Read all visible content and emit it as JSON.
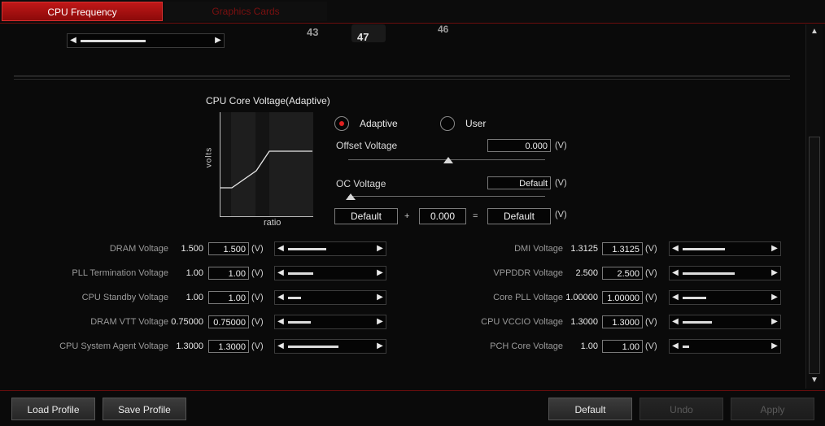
{
  "tabs": [
    {
      "label": "CPU Frequency"
    },
    {
      "label": "Graphics Cards"
    }
  ],
  "ratio_markers": [
    "43",
    "47",
    "46"
  ],
  "adaptive": {
    "title": "CPU Core Voltage(Adaptive)",
    "graph_ylabel": "volts",
    "graph_xlabel": "ratio",
    "mode_adaptive": "Adaptive",
    "mode_user": "User",
    "selected_mode": "Adaptive",
    "offset_label": "Offset Voltage",
    "offset_value": "0.000",
    "offset_unit": "(V)",
    "oc_label": "OC Voltage",
    "oc_value": "Default",
    "oc_unit": "(V)",
    "formula_left": "Default",
    "formula_plus": "+",
    "formula_mid": "0.000",
    "formula_eq": "=",
    "formula_result": "Default",
    "formula_unit": "(V)"
  },
  "unit": "(V)",
  "left_voltages": [
    {
      "label": "DRAM Voltage",
      "current": "1.500",
      "value": "1.500",
      "level": 0.45
    },
    {
      "label": "PLL Termination Voltage",
      "current": "1.00",
      "value": "1.00",
      "level": 0.3
    },
    {
      "label": "CPU Standby Voltage",
      "current": "1.00",
      "value": "1.00",
      "level": 0.15
    },
    {
      "label": "DRAM VTT Voltage",
      "current": "0.75000",
      "value": "0.75000",
      "level": 0.27
    },
    {
      "label": "CPU System Agent Voltage",
      "current": "1.3000",
      "value": "1.3000",
      "level": 0.6
    }
  ],
  "right_voltages": [
    {
      "label": "DMI Voltage",
      "current": "1.3125",
      "value": "1.3125",
      "level": 0.5
    },
    {
      "label": "VPPDDR Voltage",
      "current": "2.500",
      "value": "2.500",
      "level": 0.62
    },
    {
      "label": "Core PLL Voltage",
      "current": "1.00000",
      "value": "1.00000",
      "level": 0.28
    },
    {
      "label": "CPU VCCIO Voltage",
      "current": "1.3000",
      "value": "1.3000",
      "level": 0.35
    },
    {
      "label": "PCH Core Voltage",
      "current": "1.00",
      "value": "1.00",
      "level": 0.08
    }
  ],
  "bottom": {
    "load_profile": "Load Profile",
    "save_profile": "Save Profile",
    "default": "Default",
    "undo": "Undo",
    "apply": "Apply"
  },
  "colors": {
    "accent": "#c01818",
    "background": "#0a0a0a"
  }
}
